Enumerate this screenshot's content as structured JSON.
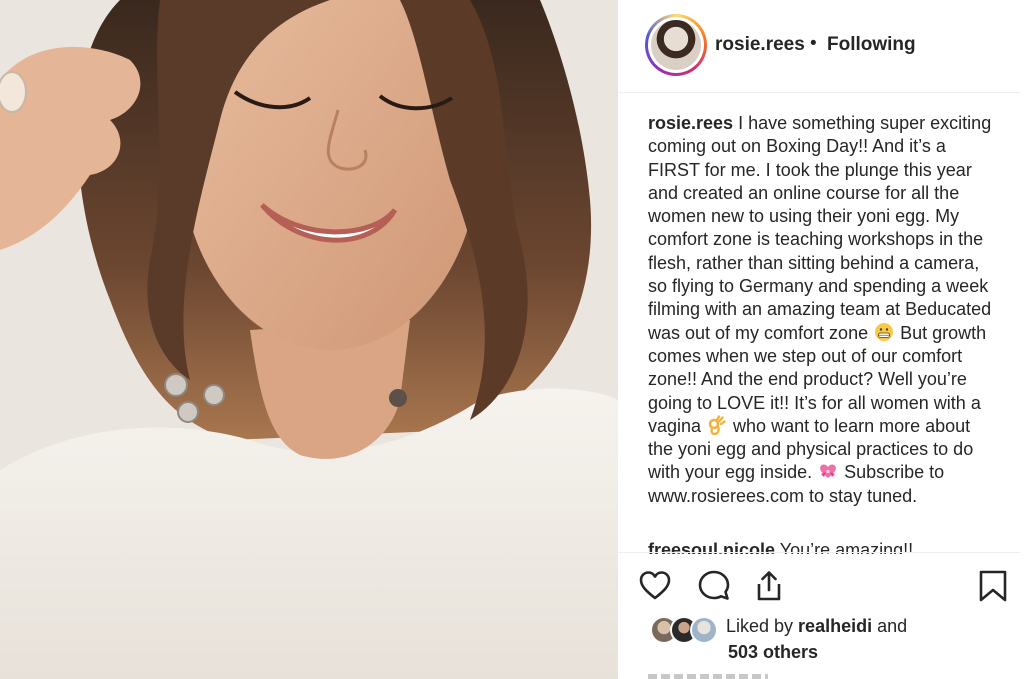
{
  "post": {
    "photo_alt_icon": "selfie-photo",
    "colors": {
      "story_ring": "#d62976",
      "link_text": "#262626",
      "border": "#efefef"
    }
  },
  "header": {
    "username": "rosie.rees",
    "separator": "•",
    "follow_status": "Following"
  },
  "caption": {
    "username": "rosie.rees",
    "text_before_emoji1": " I have something super exciting coming out on Boxing Day!! And it’s a FIRST for me. I took the plunge this year and created an online course for all the women new to using their yoni egg. My comfort zone is teaching workshops in the flesh, rather than sitting behind a camera, so flying to Germany and spending a week filming with an amazing team at Beducated was out of my comfort zone ",
    "emoji1": "grimacing-face-emoji",
    "text_before_emoji2": " But growth comes when we step out of our comfort zone!! And the end product? Well you’re going to LOVE it!! It’s for all women with a vagina ",
    "emoji2": "ok-hand-emoji",
    "text_before_emoji3": " who want to learn more about the yoni egg and physical practices to do with your egg inside. ",
    "emoji3": "heart-with-ribbon-emoji",
    "text_after_emoji3": " Subscribe to www.rosierees.com to stay tuned."
  },
  "comment": {
    "username": "freesoul.nicole",
    "text": " You’re amazing!!"
  },
  "actions": {
    "like_icon": "heart-icon",
    "comment_icon": "speech-bubble-icon",
    "share_icon": "share-icon",
    "save_icon": "bookmark-icon"
  },
  "likes": {
    "prefix": "Liked by ",
    "user": "realheidi",
    "suffix": " and",
    "others": "503 others"
  }
}
